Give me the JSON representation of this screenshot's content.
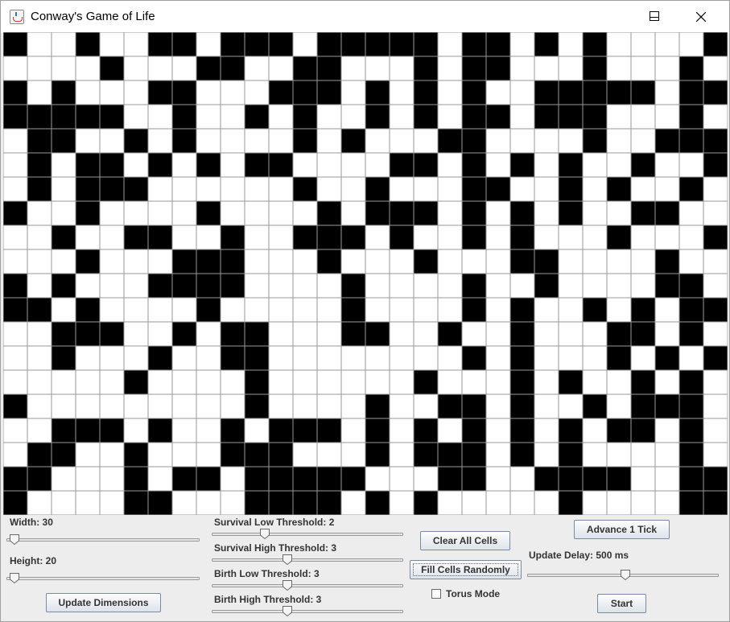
{
  "window": {
    "title": "Conway's Game of Life",
    "icon": "java-coffee-cup-icon"
  },
  "grid": {
    "columns": 30,
    "rows": 20,
    "alive_color": "#000000",
    "dead_color": "#ffffff",
    "line_color": "#999999",
    "cells": [
      "100100110111011111011010100001",
      "000010001100110001011000100010",
      "101000110001110101010011111011",
      "111110010010100101011011100010",
      "011001010000101000110000100111",
      "010110101011000011010101001001",
      "010111000000100100011001010010",
      "100100001000010111010101001100",
      "001001100100111010010100010001",
      "000100011100010001000110000100",
      "101000111100001000010010000110",
      "110100001000001000010100101011",
      "001110010110001100100100011010",
      "001000100110000000010100010101",
      "000001000010000001000101001010",
      "100000000010000100110100101110",
      "001110100101110101010101011010",
      "011001000111000101110101000010",
      "110001011011111000110011110011",
      "100001100011110101000001000011"
    ]
  },
  "controls": {
    "width": {
      "label": "Width: 30",
      "value": 30,
      "fraction": 0.0
    },
    "height": {
      "label": "Height: 20",
      "value": 20,
      "fraction": 0.0
    },
    "update_dimensions": "Update Dimensions",
    "survival_low": {
      "label": "Survival Low Threshold: 2",
      "value": 2,
      "fraction": 0.25
    },
    "survival_high": {
      "label": "Survival High Threshold: 3",
      "value": 3,
      "fraction": 0.375
    },
    "birth_low": {
      "label": "Birth Low Threshold: 3",
      "value": 3,
      "fraction": 0.375
    },
    "birth_high": {
      "label": "Birth High Threshold: 3",
      "value": 3,
      "fraction": 0.375
    },
    "clear_all": "Clear All Cells",
    "fill_random": "Fill Cells Randomly",
    "torus_mode": {
      "label": "Torus Mode",
      "checked": false
    },
    "advance_tick": "Advance 1 Tick",
    "update_delay": {
      "label": "Update Delay: 500 ms",
      "value": 500,
      "fraction": 0.5
    },
    "start": "Start"
  }
}
